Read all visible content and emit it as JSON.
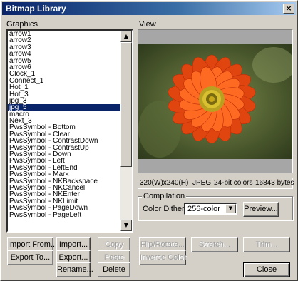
{
  "window": {
    "title": "Bitmap Library",
    "close_glyph": "×"
  },
  "graphics": {
    "label": "Graphics",
    "items": [
      "arrow1",
      "arrow2",
      "arrow3",
      "arrow4",
      "arrow5",
      "arrow6",
      "Clock_1",
      "Connect_1",
      "Hot_1",
      "Hot_3",
      "jpg_3",
      "jpg_5",
      "macro",
      "Next_3",
      "PwsSymbol - Bottom",
      "PwsSymbol - Clear",
      "PwsSymbol - ContrastDown",
      "PwsSymbol - ContrastUp",
      "PwsSymbol - Down",
      "PwsSymbol - Left",
      "PwsSymbol - LeftEnd",
      "PwsSymbol - Mark",
      "PwsSymbol - NKBackspace",
      "PwsSymbol - NKCancel",
      "PwsSymbol - NKEnter",
      "PwsSymbol - NKLimit",
      "PwsSymbol - PageDown",
      "PwsSymbol - PageLeft"
    ],
    "selected_index": 11
  },
  "view": {
    "label": "View",
    "info": {
      "size": "320(W)x240(H)",
      "format": "JPEG",
      "colors": "24-bit colors",
      "bytes": "16843 bytes"
    }
  },
  "compilation": {
    "title": "Compilation",
    "dithering_label": "Color Dithering:",
    "dithering_value": "256-color",
    "preview_label": "Preview..."
  },
  "buttons": {
    "import_from": "Import From...",
    "import": "Import...",
    "copy": "Copy",
    "flip_rotate": "Flip/Rotate...",
    "stretch": "Stretch...",
    "trim": "Trim...",
    "export_to": "Export To...",
    "export": "Export...",
    "paste": "Paste",
    "inverse_color": "Inverse Color",
    "rename": "Rename...",
    "delete": "Delete",
    "close": "Close"
  },
  "colors": {
    "selection": "#0a246a",
    "face": "#d4d0c8",
    "title_start": "#0a246a",
    "flower": "#e8501a"
  }
}
